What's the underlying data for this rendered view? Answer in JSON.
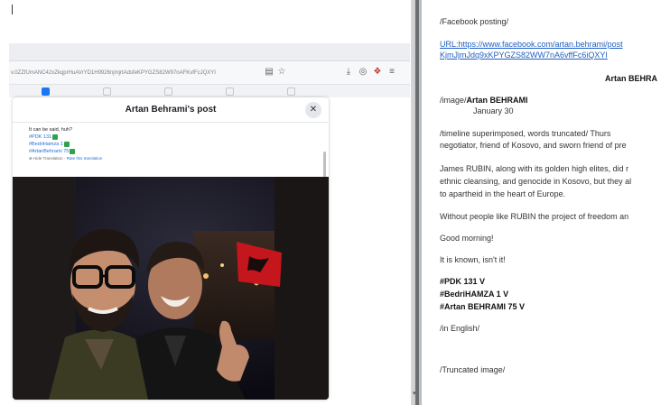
{
  "browser": {
    "url": "v.0ZZfUmANC42xZkqprHuAVrYD1H9926njmjrtAdsfeKPYGZS82W97nAFKvfFcJQXYI",
    "toolbar_icons": [
      "reader-icon",
      "star-icon",
      "download-icon",
      "shield-icon",
      "extension-icon",
      "menu-icon"
    ]
  },
  "modal": {
    "title": "Artan Behrami's post",
    "close_symbol": "✕",
    "text_intro": "It can be said, huh?",
    "hashtags": [
      "#PDK 131",
      "#BedriHamza 1",
      "#ArtanBehrami 75"
    ],
    "translate_label": "Hide Translation",
    "translate_rate": "Rate this translation"
  },
  "document": {
    "header": "/Facebook posting/",
    "url_line1": "URL:https://www.facebook.com/artan.behrami/post",
    "url_line2": "KjmJjmJdq9xKPYGZS82WW7nA6vffFc6iQXYI",
    "author_top": "Artan BEHRA",
    "image_label_prefix": "/image/",
    "image_label_name": "Artan BEHRAMI",
    "date": "January 30",
    "para1_line1": "/timeline superimposed, words truncated/ Thurs",
    "para1_line2": "negotiator, friend of Kosovo, and sworn friend of pre",
    "para2_line1": "James RUBIN, along with its golden high elites, did r",
    "para2_line2": "ethnic cleansing, and genocide in Kosovo, but they al",
    "para2_line3": "to apartheid in the heart of Europe.",
    "para3": "Without people like RUBIN the project of freedom an",
    "greeting": "Good morning!",
    "known": "It is known, isn't it!",
    "vote1": "#PDK 131 V",
    "vote2": "#BedriHAMZA 1 V",
    "vote3": "#Artan BEHRAMI 75 V",
    "in_english": "/in English/",
    "truncated": "/Truncated image/"
  },
  "colors": {
    "link": "#1f5fc4",
    "hashtag": "#216fdb",
    "check": "#31a24c",
    "divider": "#6b6e72"
  }
}
